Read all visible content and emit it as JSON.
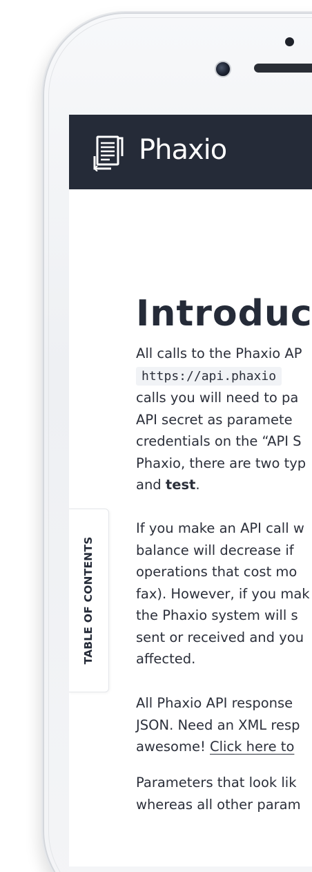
{
  "app": {
    "brand": "Phaxio"
  },
  "page": {
    "title": "Introducti"
  },
  "paragraphs": {
    "p1": {
      "l1": "All calls to the Phaxio AP",
      "l2_code": "https://api.phaxio",
      "l3": "calls you will need to pa",
      "l4": "API secret as paramete",
      "l5": "credentials on the “API S",
      "l6": "Phaxio, there are two typ",
      "l7_pre": "and ",
      "l7_strong": "test",
      "l7_post": "."
    },
    "p2": {
      "l1": "If you make an API call w",
      "l2": "balance will decrease if",
      "l3": "operations that cost mo",
      "l4": "fax). However, if you mak",
      "l5": "the Phaxio system will s",
      "l6": "sent or received and you",
      "l7": "affected."
    },
    "p3": {
      "l1": "All Phaxio API response",
      "l2": "JSON. Need an XML resp",
      "l3_pre": "awesome! ",
      "l3_link": "Click here to"
    },
    "p4": {
      "l1": "Parameters that look lik",
      "l2": "whereas all other param"
    }
  },
  "toc": {
    "label": "TABLE OF CONTENTS"
  },
  "icons": {
    "logo": "phaxio-fax-icon"
  },
  "colors": {
    "navbar": "#252b38",
    "text": "#2b2f3a",
    "code_bg": "#f1f3f6"
  }
}
